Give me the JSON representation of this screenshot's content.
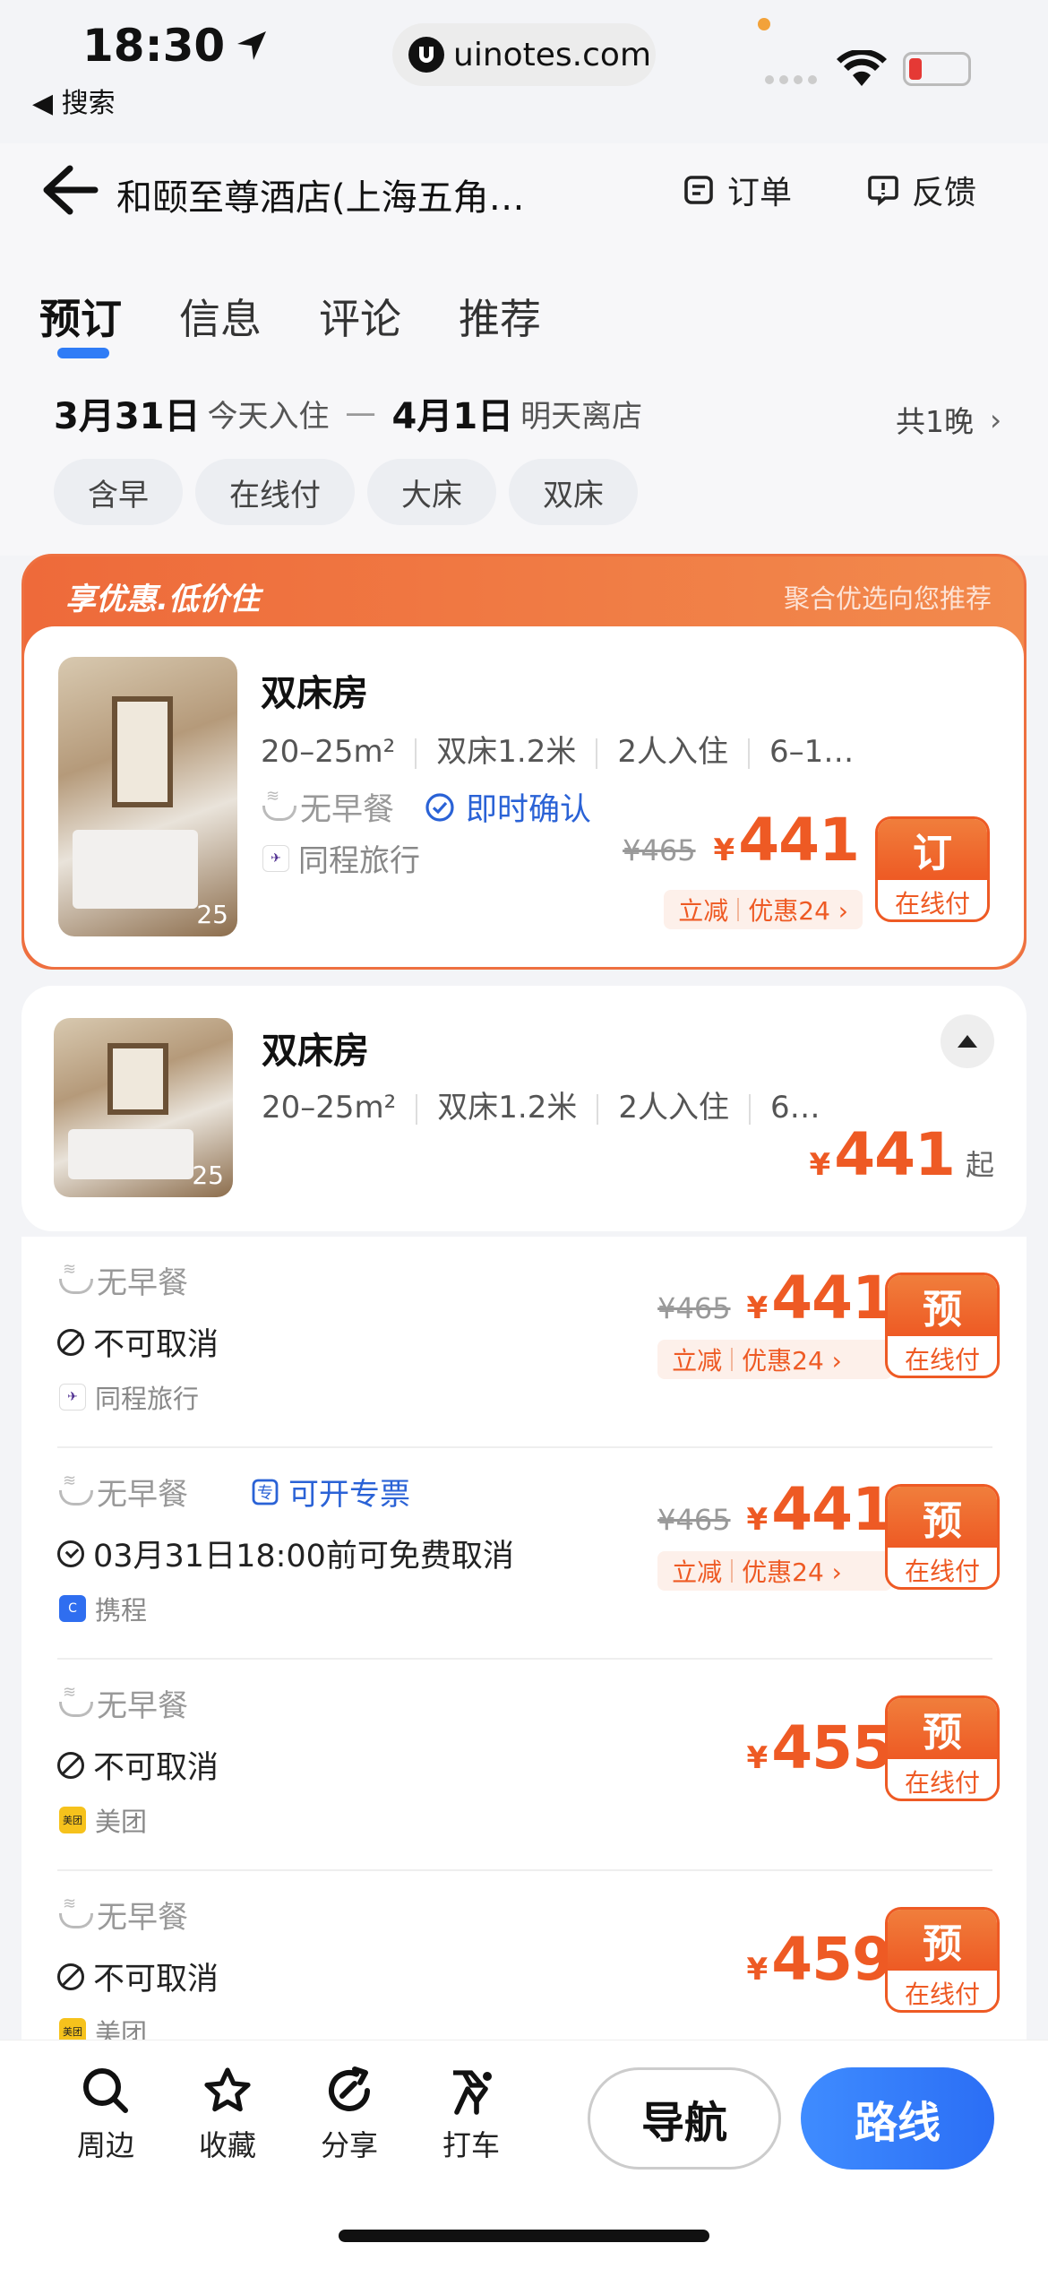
{
  "status": {
    "time": "18:30",
    "back_label": "◀ 搜索",
    "url": "uinotes.com"
  },
  "header": {
    "title": "和颐至尊酒店(上海五角…",
    "order_label": "订单",
    "feedback_label": "反馈"
  },
  "tabs": [
    "预订",
    "信息",
    "评论",
    "推荐"
  ],
  "stay": {
    "checkin_date": "3月31日",
    "checkin_note": "今天入住",
    "dash": "一",
    "checkout_date": "4月1日",
    "checkout_note": "明天离店",
    "nights": "共1晚"
  },
  "filters": [
    "含早",
    "在线付",
    "大床",
    "双床"
  ],
  "promo": {
    "title": "享优惠.低价住",
    "subtitle": "聚合优选向您推荐",
    "room": {
      "name": "双床房",
      "area": "20–25m²",
      "bed": "双床1.2米",
      "guests": "2人入住",
      "floor": "6–1…",
      "photo_count": "25",
      "breakfast": "无早餐",
      "confirm": "即时确认",
      "supplier": "同程旅行",
      "original_price": "¥465",
      "yen": "¥",
      "price": "441",
      "discount_a": "立减",
      "discount_b": "优惠24 ›",
      "btn_top": "订",
      "btn_bottom": "在线付"
    }
  },
  "room_card": {
    "name": "双床房",
    "area": "20–25m²",
    "bed": "双床1.2米",
    "guests": "2人入住",
    "floor": "6…",
    "photo_count": "25",
    "yen": "¥",
    "price": "441",
    "suffix": "起"
  },
  "offers": [
    {
      "breakfast": "无早餐",
      "invoice": "",
      "policy": "不可取消",
      "policy_icon": "cancel",
      "supplier": "同程旅行",
      "supplier_color": "#4b2a8e",
      "supplier_mark": "✈",
      "original_price": "¥465",
      "yen": "¥",
      "price": "441",
      "discount_a": "立减",
      "discount_b": "优惠24 ›",
      "btn_top": "预",
      "btn_bottom": "在线付"
    },
    {
      "breakfast": "无早餐",
      "invoice": "可开专票",
      "policy": "03月31日18:00前可免费取消",
      "policy_icon": "check",
      "supplier": "携程",
      "supplier_color": "#2f6ef0",
      "supplier_mark": "C",
      "original_price": "¥465",
      "yen": "¥",
      "price": "441",
      "discount_a": "立减",
      "discount_b": "优惠24 ›",
      "btn_top": "预",
      "btn_bottom": "在线付"
    },
    {
      "breakfast": "无早餐",
      "invoice": "",
      "policy": "不可取消",
      "policy_icon": "cancel",
      "supplier": "美团",
      "supplier_color": "#f6c21c",
      "supplier_mark": "美团",
      "original_price": "",
      "yen": "¥",
      "price": "455",
      "discount_a": "",
      "discount_b": "",
      "btn_top": "预",
      "btn_bottom": "在线付"
    },
    {
      "breakfast": "无早餐",
      "invoice": "",
      "policy": "不可取消",
      "policy_icon": "cancel",
      "supplier": "美团",
      "supplier_color": "#f6c21c",
      "supplier_mark": "美团",
      "original_price": "",
      "yen": "¥",
      "price": "459",
      "discount_a": "",
      "discount_b": "",
      "btn_top": "预",
      "btn_bottom": "在线付"
    }
  ],
  "bottom_bar": {
    "nearby": "周边",
    "favorite": "收藏",
    "share": "分享",
    "taxi": "打车",
    "navigate": "导航",
    "route": "路线"
  }
}
